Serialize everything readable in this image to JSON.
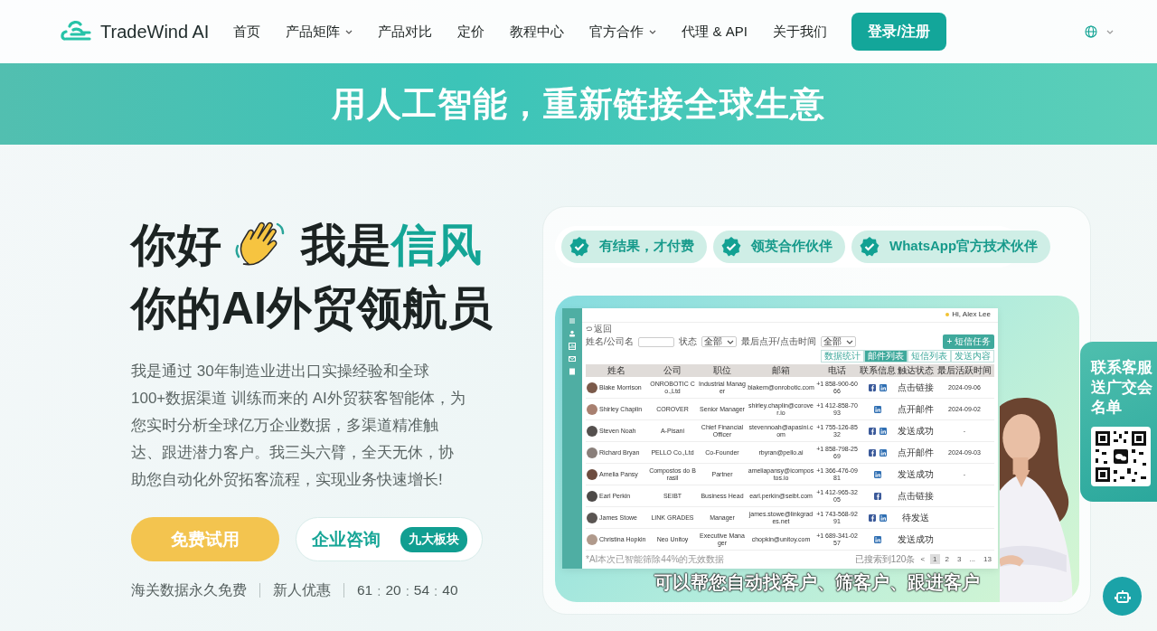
{
  "nav": {
    "logo": "TradeWind AI",
    "items": [
      {
        "label": "首页",
        "dropdown": false
      },
      {
        "label": "产品矩阵",
        "dropdown": true
      },
      {
        "label": "产品对比",
        "dropdown": false
      },
      {
        "label": "定价",
        "dropdown": false
      },
      {
        "label": "教程中心",
        "dropdown": false
      },
      {
        "label": "官方合作",
        "dropdown": true
      },
      {
        "label": "代理 & API",
        "dropdown": false
      },
      {
        "label": "关于我们",
        "dropdown": false
      }
    ],
    "login": "登录/注册"
  },
  "banner": "用人工智能，重新链接全球生意",
  "hero": {
    "greeting": "你好",
    "intro": "我是",
    "name": "信风",
    "tagline": "你的AI外贸领航员",
    "description": "我是通过 30年制造业进出口实操经验和全球 100+数据渠道 训练而来的 AI外贸获客智能体，为您实时分析全球亿万企业数据，多渠道精准触达、跟进潜力客户。我三头六臂，全天无休，协助您自动化外贸拓客流程，实现业务快速增长!",
    "primary_button": "免费试用",
    "secondary_button": "企业咨询",
    "secondary_badge": "九大板块",
    "perks": [
      "海关数据永久免费",
      "新人优惠"
    ],
    "countdown": {
      "separator": ":",
      "parts": [
        "61",
        "20",
        "54",
        "40"
      ]
    }
  },
  "showcase": {
    "badges": [
      "有结果，才付费",
      "领英合作伙伴",
      "WhatsApp官方技术伙伴"
    ],
    "mockup": {
      "greeting": "Hi, Alex Lee",
      "back": "返回",
      "filters": [
        {
          "kind": "input",
          "label": "姓名/公司名"
        },
        {
          "kind": "select",
          "label": "状态",
          "value": "全部"
        },
        {
          "kind": "select",
          "label": "最后点开/点击时间",
          "value": "全部"
        }
      ],
      "action": "+ 短信任务",
      "tabs": [
        {
          "label": "数据统计",
          "selected": false
        },
        {
          "label": "邮件列表",
          "selected": true
        },
        {
          "label": "短信列表",
          "selected": false
        },
        {
          "label": "发送内容",
          "selected": false
        }
      ],
      "columns": [
        "姓名",
        "公司",
        "职位",
        "邮箱",
        "电话",
        "联系信息",
        "触达状态",
        "最后活跃时间"
      ],
      "rows": [
        {
          "name": "Blake Morrison",
          "company": "ONROBOTIC Co.,Ltd",
          "title": "Industrial Manager",
          "email": "blakem@onrobotic.com",
          "phone": "+1 858-900-6066",
          "facebook": true,
          "linkedin": true,
          "status": "点击链接",
          "last_active": "2024-09-06"
        },
        {
          "name": "Shirley Chaplin",
          "company": "COROVER",
          "title": "Senior Manager",
          "email": "shirley.chaplin@corover.io",
          "phone": "+1 412-858-7093",
          "facebook": false,
          "linkedin": true,
          "status": "点开邮件",
          "last_active": "2024-09-02"
        },
        {
          "name": "Steven Noah",
          "company": "A-Pisani",
          "title": "Chief Financial Officer",
          "email": "stevennoah@apasini.com",
          "phone": "+1 755-126-8532",
          "facebook": true,
          "linkedin": true,
          "status": "发送成功",
          "last_active": "-"
        },
        {
          "name": "Richard Bryan",
          "company": "PELLO Co.,Ltd",
          "title": "Co-Founder",
          "email": "rbyran@pello.ai",
          "phone": "+1 858-798-2569",
          "facebook": true,
          "linkedin": true,
          "status": "点开邮件",
          "last_active": "2024-09-03"
        },
        {
          "name": "Amelia Pansy",
          "company": "Compostos do Brasil",
          "title": "Partner",
          "email": "ameliapansy@icompostos.io",
          "phone": "+1 366-476-0981",
          "facebook": false,
          "linkedin": true,
          "status": "发送成功",
          "last_active": "-"
        },
        {
          "name": "Earl Perkin",
          "company": "SEIBT",
          "title": "Business Head",
          "email": "earl.perkin@seibt.com",
          "phone": "+1 412-965-3205",
          "facebook": true,
          "linkedin": false,
          "status": "点击链接"
        },
        {
          "name": "James Stowe",
          "company": "LINK GRADES",
          "title": "Manager",
          "email": "james.stowe@linkgrades.net",
          "phone": "+1 743-568-9291",
          "facebook": true,
          "linkedin": true,
          "status": "待发送"
        },
        {
          "name": "Christina Hopkin",
          "company": "Neo Unitoy",
          "title": "Executive Manager",
          "email": "chopkin@unitoy.com",
          "phone": "+1 689-341-0257",
          "facebook": false,
          "linkedin": true,
          "status": "发送成功"
        }
      ],
      "note": "*AI本次已智能筛除44%的无效数据",
      "result_count": "已搜索到120条",
      "prev": "<",
      "pages": [
        {
          "label": "1",
          "selected": true
        },
        {
          "label": "2",
          "selected": false
        },
        {
          "label": "3",
          "selected": false
        },
        {
          "label": "...",
          "selected": false
        },
        {
          "label": "13",
          "selected": false
        }
      ]
    },
    "caption": "可以帮您自动找客户、筛客户、跟进客户"
  },
  "contact_card": {
    "text": "联系客服送广交会名单"
  }
}
